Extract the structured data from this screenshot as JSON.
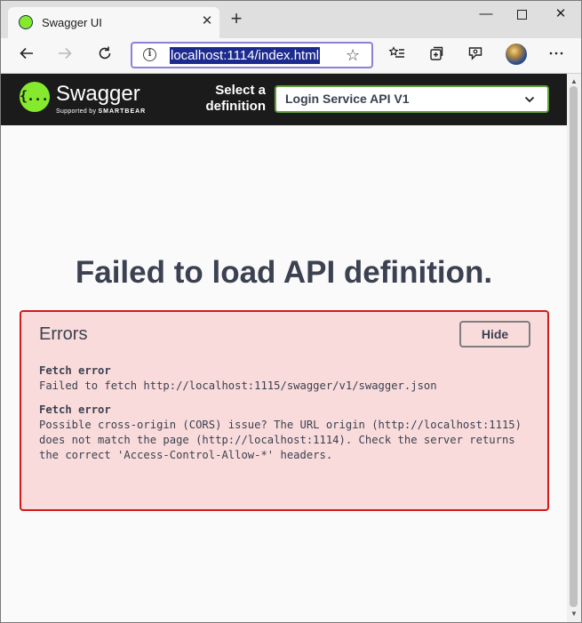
{
  "browser": {
    "tab_title": "Swagger UI",
    "tab_close": "✕",
    "new_tab": "+",
    "url": "localhost:1114/index.html",
    "minimize": "—",
    "close": "✕"
  },
  "swagger": {
    "brand": "Swagger",
    "brand_sub_prefix": "Supported by ",
    "brand_sub_company": "SMARTBEAR",
    "select_label": "Select a definition",
    "selected_definition": "Login Service API V1"
  },
  "main": {
    "title": "Failed to load API definition.",
    "errors_heading": "Errors",
    "hide_label": "Hide",
    "errors": [
      {
        "title": "Fetch error",
        "message": "Failed to fetch http://localhost:1115/swagger/v1/swagger.json"
      },
      {
        "title": "Fetch error",
        "message": "Possible cross-origin (CORS) issue? The URL origin (http://localhost:1115) does not match the page (http://localhost:1114). Check the server returns the correct 'Access-Control-Allow-*' headers."
      }
    ]
  },
  "colors": {
    "swagger_green": "#85ea2d",
    "topbar": "#1b1b1b",
    "error_border": "#d11a1a",
    "error_bg": "#f9dbdb",
    "text": "#3b4151"
  }
}
